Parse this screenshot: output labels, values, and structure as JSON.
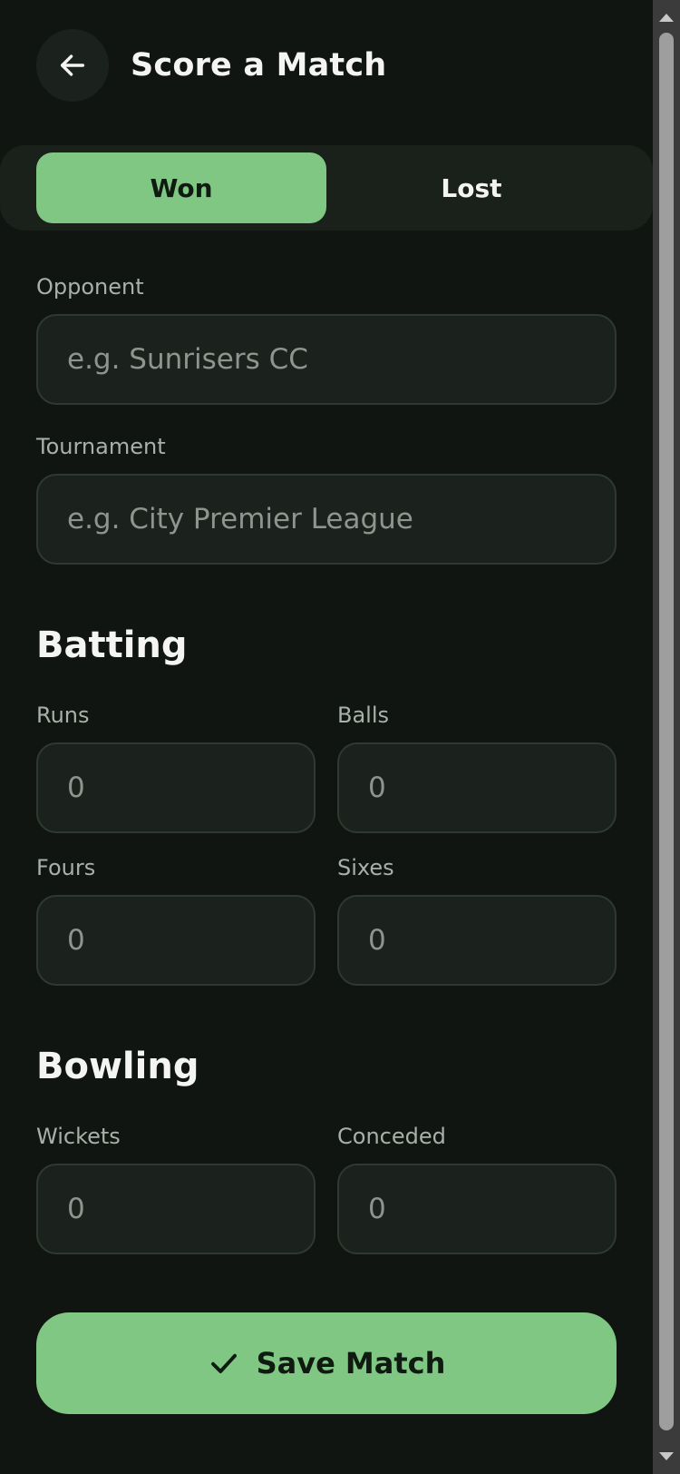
{
  "header": {
    "title": "Score a Match",
    "back_icon": "arrow-left-icon"
  },
  "result_toggle": {
    "options": [
      "Won",
      "Lost"
    ],
    "selected": "Won"
  },
  "match_details": {
    "opponent": {
      "label": "Opponent",
      "placeholder": "e.g. Sunrisers CC",
      "value": ""
    },
    "tournament": {
      "label": "Tournament",
      "placeholder": "e.g. City Premier League",
      "value": ""
    }
  },
  "batting": {
    "title": "Batting",
    "runs": {
      "label": "Runs",
      "placeholder": "0"
    },
    "balls": {
      "label": "Balls",
      "placeholder": "0"
    },
    "fours": {
      "label": "Fours",
      "placeholder": "0"
    },
    "sixes": {
      "label": "Sixes",
      "placeholder": "0"
    }
  },
  "bowling": {
    "title": "Bowling",
    "wickets": {
      "label": "Wickets",
      "placeholder": "0"
    },
    "conceded": {
      "label": "Conceded",
      "placeholder": "0"
    }
  },
  "save": {
    "label": "Save Match",
    "icon": "check-icon"
  },
  "colors": {
    "background": "#101511",
    "surface": "#1b211c",
    "accent": "#81c784",
    "border": "#2f3930",
    "label": "#a9b0a9",
    "placeholder": "#8d958e"
  }
}
